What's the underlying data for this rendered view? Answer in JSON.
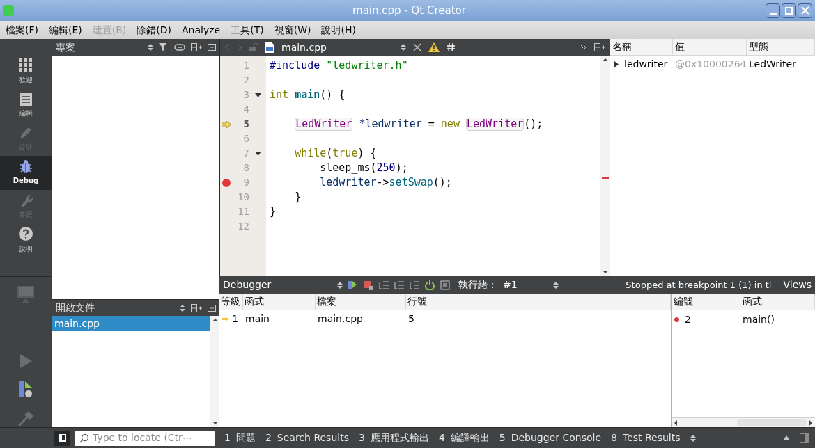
{
  "window": {
    "title": "main.cpp - Qt Creator"
  },
  "menu": [
    {
      "label": "檔案(F)",
      "disabled": false
    },
    {
      "label": "編輯(E)",
      "disabled": false
    },
    {
      "label": "建置(B)",
      "disabled": true
    },
    {
      "label": "除錯(D)",
      "disabled": false
    },
    {
      "label": "Analyze",
      "disabled": false
    },
    {
      "label": "工具(T)",
      "disabled": false
    },
    {
      "label": "視窗(W)",
      "disabled": false
    },
    {
      "label": "說明(H)",
      "disabled": false
    }
  ],
  "modes": [
    {
      "kind": "grid",
      "label": "歡迎",
      "selected": false,
      "disabled": false
    },
    {
      "kind": "doc",
      "label": "編輯",
      "selected": false,
      "disabled": false
    },
    {
      "kind": "pencil",
      "label": "設計",
      "selected": false,
      "disabled": true
    },
    {
      "kind": "bug",
      "label": "Debug",
      "selected": true,
      "disabled": false
    },
    {
      "kind": "wrench",
      "label": "專案",
      "selected": false,
      "disabled": true
    },
    {
      "kind": "help",
      "label": "說明",
      "selected": false,
      "disabled": false
    }
  ],
  "project_panel": {
    "title": "專案"
  },
  "open_documents": {
    "title": "開啟文件",
    "items": [
      {
        "label": "main.cpp",
        "selected": true
      }
    ]
  },
  "editor": {
    "file": "main.cpp",
    "lines": [
      {
        "number": "1",
        "fold": false,
        "current": false,
        "breakpoint": false,
        "tokens": [
          {
            "kind": "pre",
            "text": "#include "
          },
          {
            "kind": "str",
            "text": "\"ledwriter.h\""
          }
        ]
      },
      {
        "number": "2",
        "fold": false,
        "current": false,
        "breakpoint": false
      },
      {
        "number": "3",
        "fold": true,
        "current": false,
        "breakpoint": false,
        "tokens": [
          {
            "kind": "kw",
            "text": "int "
          },
          {
            "kind": "fn",
            "text": "main"
          },
          {
            "kind": "plain",
            "text": "() {"
          }
        ]
      },
      {
        "number": "4",
        "fold": false,
        "current": false,
        "breakpoint": false
      },
      {
        "number": "5",
        "fold": false,
        "current": true,
        "breakpoint": false,
        "tokens": [
          {
            "kind": "type",
            "text": "    LedWriter"
          },
          {
            "kind": "var",
            "text": " *ledwriter"
          },
          {
            "kind": "plain",
            "text": " = "
          },
          {
            "kind": "kw",
            "text": "new "
          },
          {
            "kind": "type",
            "text": "LedWriter"
          },
          {
            "kind": "plain",
            "text": "();"
          }
        ]
      },
      {
        "number": "6",
        "fold": false,
        "current": false,
        "breakpoint": false
      },
      {
        "number": "7",
        "fold": true,
        "current": false,
        "breakpoint": false,
        "tokens": [
          {
            "kind": "kw",
            "text": "    while"
          },
          {
            "kind": "plain",
            "text": "("
          },
          {
            "kind": "kw",
            "text": "true"
          },
          {
            "kind": "plain",
            "text": ") {"
          }
        ]
      },
      {
        "number": "8",
        "fold": false,
        "current": false,
        "breakpoint": false,
        "tokens": [
          {
            "kind": "plain",
            "text": "        sleep_ms("
          },
          {
            "kind": "num",
            "text": "250"
          },
          {
            "kind": "plain",
            "text": ");"
          }
        ]
      },
      {
        "number": "9",
        "fold": false,
        "current": false,
        "breakpoint": true,
        "tokens": [
          {
            "kind": "var",
            "text": "        ledwriter"
          },
          {
            "kind": "plain",
            "text": "->"
          },
          {
            "kind": "call",
            "text": "setSwap"
          },
          {
            "kind": "plain",
            "text": "();"
          }
        ]
      },
      {
        "number": "10",
        "fold": false,
        "current": false,
        "breakpoint": false,
        "tokens": [
          {
            "kind": "plain",
            "text": "    }"
          }
        ]
      },
      {
        "number": "11",
        "fold": false,
        "current": false,
        "breakpoint": false,
        "tokens": [
          {
            "kind": "plain",
            "text": "}"
          }
        ]
      },
      {
        "number": "12",
        "fold": false,
        "current": false,
        "breakpoint": false
      }
    ]
  },
  "locals": {
    "columns": [
      "名稱",
      "值",
      "型態"
    ],
    "rows": [
      {
        "name": "ledwriter",
        "value": "@0x10000264",
        "type": "LedWriter",
        "expanded": false
      }
    ]
  },
  "debugger": {
    "title": "Debugger",
    "thread_label": "執行緒：",
    "thread": "#1",
    "status": "Stopped at breakpoint 1 (1) in tl",
    "views": "Views"
  },
  "stack": {
    "columns": [
      "等級",
      "函式",
      "檔案",
      "行號"
    ],
    "rows": [
      {
        "level": "1",
        "function": "main",
        "file": "main.cpp",
        "line": "5"
      }
    ]
  },
  "breakpoints": {
    "columns": [
      "編號",
      "函式"
    ],
    "rows": [
      {
        "number": "2",
        "function": "main()",
        "color": "#e0393b"
      }
    ]
  },
  "locator": {
    "placeholder": "Type to locate (Ctr⋯"
  },
  "output_tabs": [
    {
      "number": "1",
      "label": "問題"
    },
    {
      "number": "2",
      "label": "Search Results"
    },
    {
      "number": "3",
      "label": "應用程式輸出"
    },
    {
      "number": "4",
      "label": "編譯輸出"
    },
    {
      "number": "5",
      "label": "Debugger Console"
    },
    {
      "number": "8",
      "label": "Test Results"
    }
  ]
}
